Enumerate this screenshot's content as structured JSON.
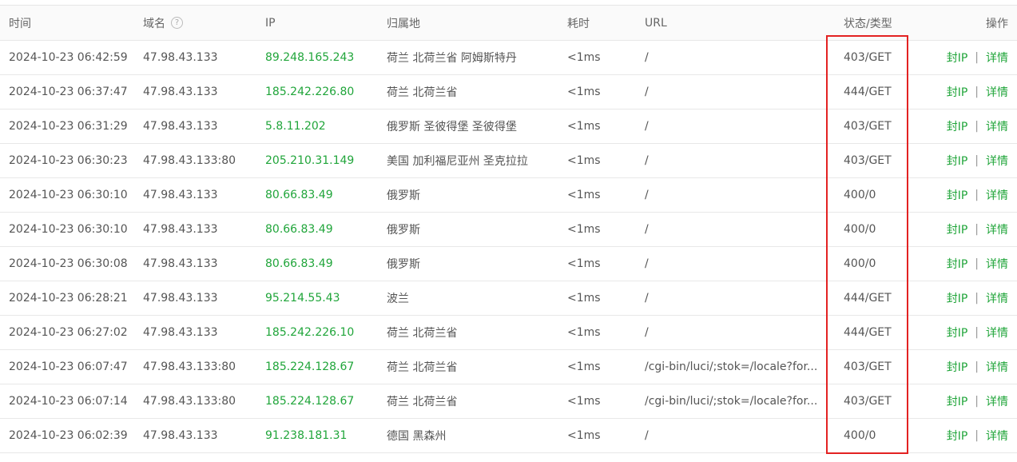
{
  "columns": {
    "time": "时间",
    "domain": "域名",
    "domain_help": "?",
    "ip": "IP",
    "location": "归属地",
    "cost": "耗时",
    "url": "URL",
    "status": "状态/类型",
    "ops": "操作"
  },
  "actions": {
    "block_ip": "封IP",
    "separator": "|",
    "details": "详情"
  },
  "rows": [
    {
      "time": "2024-10-23 06:42:59",
      "domain": "47.98.43.133",
      "ip": "89.248.165.243",
      "location": "荷兰 北荷兰省 阿姆斯特丹",
      "cost": "<1ms",
      "url": "/",
      "status": "403/GET"
    },
    {
      "time": "2024-10-23 06:37:47",
      "domain": "47.98.43.133",
      "ip": "185.242.226.80",
      "location": "荷兰 北荷兰省",
      "cost": "<1ms",
      "url": "/",
      "status": "444/GET"
    },
    {
      "time": "2024-10-23 06:31:29",
      "domain": "47.98.43.133",
      "ip": "5.8.11.202",
      "location": "俄罗斯 圣彼得堡 圣彼得堡",
      "cost": "<1ms",
      "url": "/",
      "status": "403/GET"
    },
    {
      "time": "2024-10-23 06:30:23",
      "domain": "47.98.43.133:80",
      "ip": "205.210.31.149",
      "location": "美国 加利福尼亚州 圣克拉拉",
      "cost": "<1ms",
      "url": "/",
      "status": "403/GET"
    },
    {
      "time": "2024-10-23 06:30:10",
      "domain": "47.98.43.133",
      "ip": "80.66.83.49",
      "location": "俄罗斯",
      "cost": "<1ms",
      "url": "/",
      "status": "400/0"
    },
    {
      "time": "2024-10-23 06:30:10",
      "domain": "47.98.43.133",
      "ip": "80.66.83.49",
      "location": "俄罗斯",
      "cost": "<1ms",
      "url": "/",
      "status": "400/0"
    },
    {
      "time": "2024-10-23 06:30:08",
      "domain": "47.98.43.133",
      "ip": "80.66.83.49",
      "location": "俄罗斯",
      "cost": "<1ms",
      "url": "/",
      "status": "400/0"
    },
    {
      "time": "2024-10-23 06:28:21",
      "domain": "47.98.43.133",
      "ip": "95.214.55.43",
      "location": "波兰",
      "cost": "<1ms",
      "url": "/",
      "status": "444/GET"
    },
    {
      "time": "2024-10-23 06:27:02",
      "domain": "47.98.43.133",
      "ip": "185.242.226.10",
      "location": "荷兰 北荷兰省",
      "cost": "<1ms",
      "url": "/",
      "status": "444/GET"
    },
    {
      "time": "2024-10-23 06:07:47",
      "domain": "47.98.43.133:80",
      "ip": "185.224.128.67",
      "location": "荷兰 北荷兰省",
      "cost": "<1ms",
      "url": "/cgi-bin/luci/;stok=/locale?for...",
      "status": "403/GET"
    },
    {
      "time": "2024-10-23 06:07:14",
      "domain": "47.98.43.133:80",
      "ip": "185.224.128.67",
      "location": "荷兰 北荷兰省",
      "cost": "<1ms",
      "url": "/cgi-bin/luci/;stok=/locale?for...",
      "status": "403/GET"
    },
    {
      "time": "2024-10-23 06:02:39",
      "domain": "47.98.43.133",
      "ip": "91.238.181.31",
      "location": "德国 黑森州",
      "cost": "<1ms",
      "url": "/",
      "status": "400/0"
    }
  ],
  "colors": {
    "accent_green": "#20a53a",
    "highlight_red": "#e32222"
  }
}
